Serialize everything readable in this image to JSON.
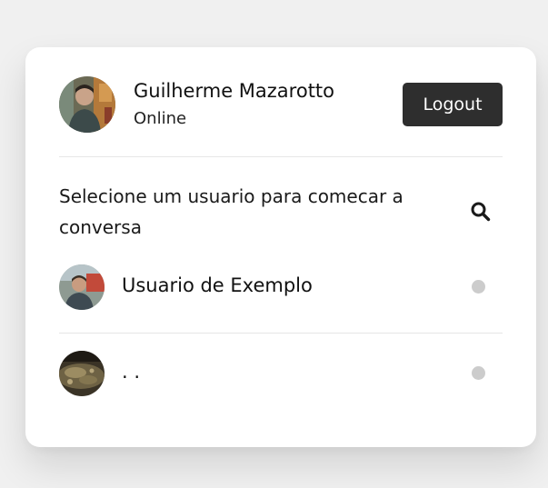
{
  "user": {
    "name": "Guilherme Mazarotto",
    "status": "Online"
  },
  "header": {
    "logout_label": "Logout"
  },
  "prompt": {
    "text": "Selecione um usuario para comecar a conversa"
  },
  "contacts": [
    {
      "name": "Usuario de Exemplo",
      "status_color": "#cccccc"
    },
    {
      "name": ". .",
      "status_color": "#cccccc"
    }
  ],
  "icons": {
    "search": "search-icon",
    "status": "status-dot-icon"
  },
  "colors": {
    "logout_bg": "#2e2e2e",
    "status_offline": "#cccccc"
  }
}
